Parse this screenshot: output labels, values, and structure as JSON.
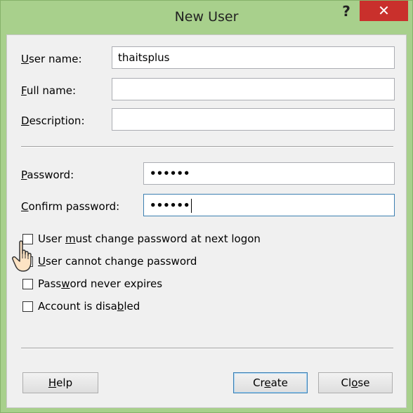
{
  "window": {
    "title": "New User",
    "help_glyph": "?",
    "close_glyph": "✕"
  },
  "form": {
    "username": {
      "label": "User name:",
      "mnemonic": "U",
      "rest": "ser name:",
      "value": "thaitsplus"
    },
    "fullname": {
      "label": "Full name:",
      "mnemonic": "F",
      "rest": "ull name:",
      "value": ""
    },
    "description": {
      "label": "Description:",
      "mnemonic": "D",
      "rest": "escription:",
      "value": ""
    },
    "password": {
      "label": "Password:",
      "mnemonic": "P",
      "rest": "assword:",
      "value": "••••••"
    },
    "confirm": {
      "label": "Confirm password:",
      "mnemonic": "C",
      "rest": "onfirm password:",
      "value": "••••••"
    }
  },
  "options": [
    {
      "label": "User must change password at next logon",
      "pre": "User ",
      "mnemonic": "m",
      "post": "ust change password at next logon",
      "checked": false
    },
    {
      "label": "User cannot change password",
      "pre": "",
      "mnemonic": "U",
      "post": "ser cannot change password",
      "checked": false
    },
    {
      "label": "Password never expires",
      "pre": "Pass",
      "mnemonic": "w",
      "post": "ord never expires",
      "checked": false
    },
    {
      "label": "Account is disabled",
      "pre": "Account is disa",
      "mnemonic": "b",
      "post": "led",
      "checked": false
    }
  ],
  "buttons": {
    "help": {
      "pre": "",
      "mnemonic": "H",
      "post": "elp"
    },
    "create": {
      "pre": "Cr",
      "mnemonic": "e",
      "post": "ate"
    },
    "close": {
      "pre": "Cl",
      "mnemonic": "o",
      "post": "se"
    }
  },
  "icons": {
    "cursor": "hand-pointer-icon"
  },
  "colors": {
    "titlebar": "#a8d08c",
    "close_button": "#c9302c",
    "focus_border": "#3c7fb1"
  }
}
